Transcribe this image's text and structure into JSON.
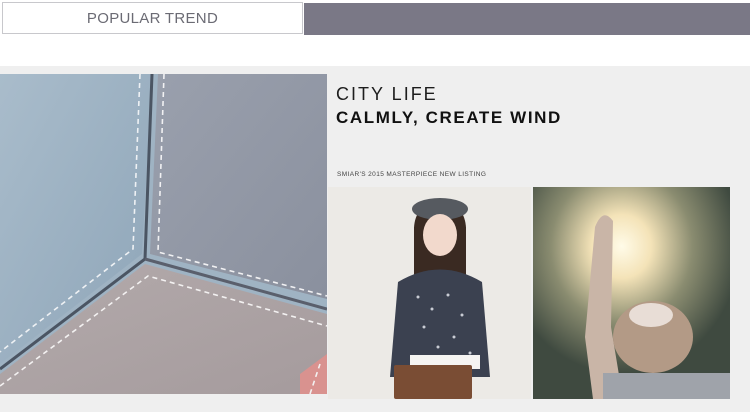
{
  "header": {
    "tab_label": "POPULAR TREND"
  },
  "promo": {
    "title": "CITY LIFE",
    "subtitle": "CALMLY, CREATE WIND",
    "listing": "SMIAR'S 2015 MASTERPIECE NEW LISTING"
  },
  "colors": {
    "header_fill": "#7a7886",
    "panel_bg": "#efefef",
    "text_dark": "#111111"
  }
}
